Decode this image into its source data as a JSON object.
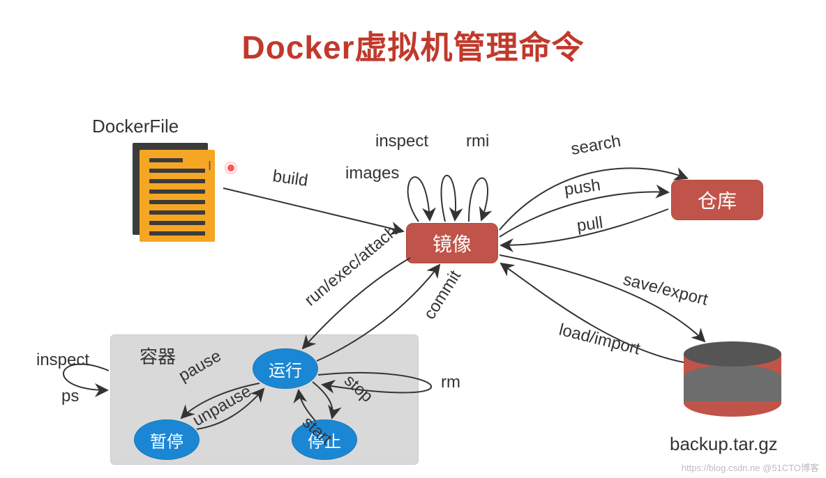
{
  "title": "Docker虚拟机管理命令",
  "labels": {
    "dockerfile": "DockerFile",
    "container": "容器",
    "backup": "backup.tar.gz",
    "watermark": "https://blog.csdn.ne @51CTO博客"
  },
  "nodes": {
    "image": "镜像",
    "repo": "仓库",
    "running": "运行",
    "paused": "暂停",
    "stopped": "停止"
  },
  "edges": {
    "build": "build",
    "inspect_img": "inspect",
    "rmi": "rmi",
    "images": "images",
    "search": "search",
    "push": "push",
    "pull": "pull",
    "save_export": "save/export",
    "load_import": "load/import",
    "run_exec_attach": "run/exec/attach",
    "commit": "commit",
    "rm": "rm",
    "inspect_ctr": "inspect",
    "ps": "ps",
    "pause": "pause",
    "unpause": "unpause",
    "stop": "stop",
    "start": "start"
  }
}
